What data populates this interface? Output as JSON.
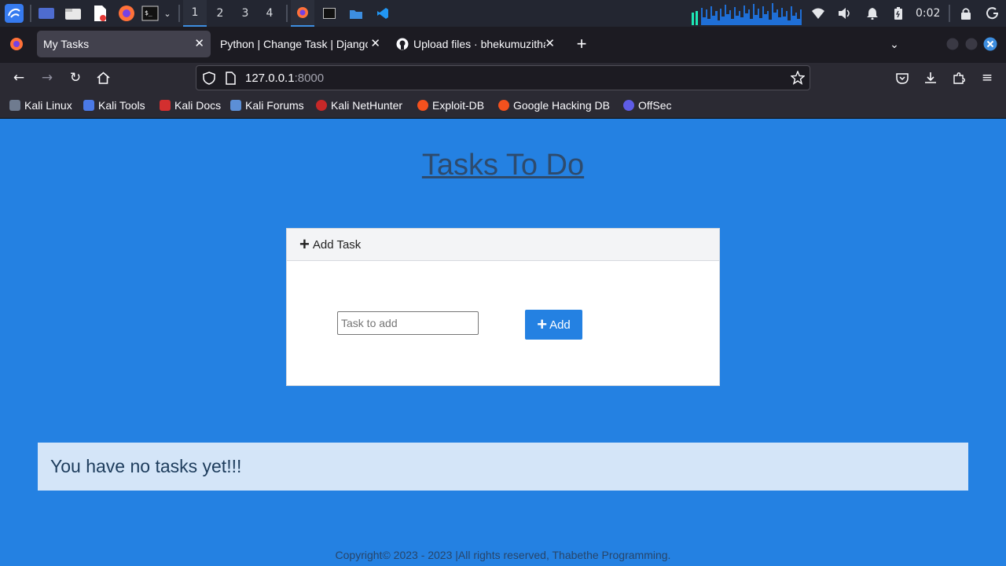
{
  "taskbar": {
    "workspaces": [
      "1",
      "2",
      "3",
      "4"
    ],
    "active_workspace": "1",
    "clock": "0:02"
  },
  "browser": {
    "tabs": [
      {
        "title": "My Tasks",
        "active": true
      },
      {
        "title": "Python | Change Task | Django",
        "active": false
      },
      {
        "title": "Upload files · bhekumuzitha",
        "active": false
      }
    ],
    "url_host": "127.0.0.1",
    "url_port": ":8000",
    "bookmarks": [
      "Kali Linux",
      "Kali Tools",
      "Kali Docs",
      "Kali Forums",
      "Kali NetHunter",
      "Exploit-DB",
      "Google Hacking DB",
      "OffSec"
    ]
  },
  "page": {
    "title": "Tasks To Do",
    "card_header": "Add Task",
    "input_placeholder": "Task to add",
    "input_value": "",
    "add_button": "Add",
    "empty_message": "You have no tasks yet!!!",
    "footer": "Copyright© 2023 - 2023 |All rights reserved, Thabethe Programming."
  },
  "colors": {
    "page_bg": "#2481e2",
    "accent": "#2481e2",
    "empty_box_bg": "#d4e5f8"
  }
}
